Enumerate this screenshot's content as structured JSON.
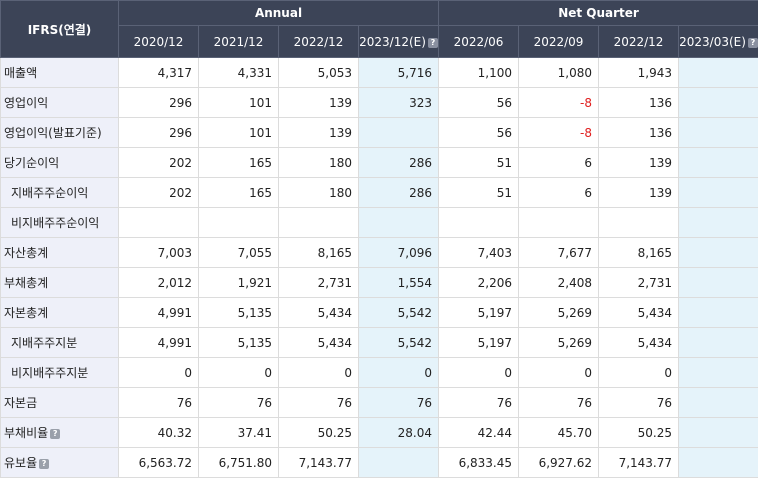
{
  "header": {
    "corner_label": "IFRS(연결)",
    "group_annual": "Annual",
    "group_quarter": "Net Quarter",
    "columns": [
      "2020/12",
      "2021/12",
      "2022/12",
      "2023/12(E)",
      "2022/06",
      "2022/09",
      "2022/12",
      "2023/03(E)"
    ]
  },
  "rows": [
    {
      "label": "매출액",
      "values": [
        "4,317",
        "4,331",
        "5,053",
        "5,716",
        "1,100",
        "1,080",
        "1,943",
        ""
      ]
    },
    {
      "label": "영업이익",
      "values": [
        "296",
        "101",
        "139",
        "323",
        "56",
        "-8",
        "136",
        ""
      ]
    },
    {
      "label": "영업이익(발표기준)",
      "values": [
        "296",
        "101",
        "139",
        "",
        "56",
        "-8",
        "136",
        ""
      ]
    },
    {
      "label": "당기순이익",
      "values": [
        "202",
        "165",
        "180",
        "286",
        "51",
        "6",
        "139",
        ""
      ]
    },
    {
      "label": "지배주주순이익",
      "values": [
        "202",
        "165",
        "180",
        "286",
        "51",
        "6",
        "139",
        ""
      ]
    },
    {
      "label": "비지배주주순이익",
      "values": [
        "",
        "",
        "",
        "",
        "",
        "",
        "",
        ""
      ]
    },
    {
      "label": "자산총계",
      "values": [
        "7,003",
        "7,055",
        "8,165",
        "7,096",
        "7,403",
        "7,677",
        "8,165",
        ""
      ]
    },
    {
      "label": "부채총계",
      "values": [
        "2,012",
        "1,921",
        "2,731",
        "1,554",
        "2,206",
        "2,408",
        "2,731",
        ""
      ]
    },
    {
      "label": "자본총계",
      "values": [
        "4,991",
        "5,135",
        "5,434",
        "5,542",
        "5,197",
        "5,269",
        "5,434",
        ""
      ]
    },
    {
      "label": "지배주주지분",
      "values": [
        "4,991",
        "5,135",
        "5,434",
        "5,542",
        "5,197",
        "5,269",
        "5,434",
        ""
      ]
    },
    {
      "label": "비지배주주지분",
      "values": [
        "0",
        "0",
        "0",
        "0",
        "0",
        "0",
        "0",
        ""
      ]
    },
    {
      "label": "자본금",
      "values": [
        "76",
        "76",
        "76",
        "76",
        "76",
        "76",
        "76",
        ""
      ]
    },
    {
      "label": "부채비율",
      "values": [
        "40.32",
        "37.41",
        "50.25",
        "28.04",
        "42.44",
        "45.70",
        "50.25",
        ""
      ]
    },
    {
      "label": "유보율",
      "values": [
        "6,563.72",
        "6,751.80",
        "7,143.77",
        "",
        "6,833.45",
        "6,927.62",
        "7,143.77",
        ""
      ]
    }
  ],
  "help_icon_glyph": "?",
  "colors": {
    "header_bg": "#3c4457",
    "label_bg": "#eef0f9",
    "estimate_bg": "#e5f3fa",
    "negative": "#e02020"
  }
}
